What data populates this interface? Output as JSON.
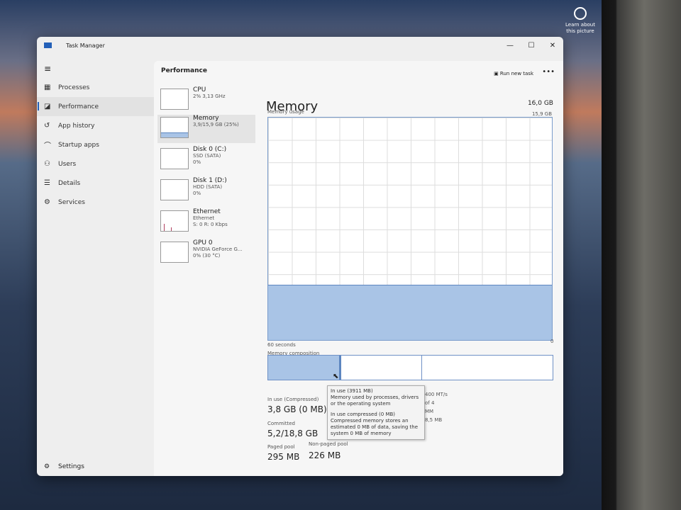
{
  "desktop": {
    "learn_label": "Learn about this picture"
  },
  "window": {
    "title": "Task Manager",
    "controls": [
      "—",
      "☐",
      "✕"
    ]
  },
  "sidebar": {
    "items": [
      {
        "label": "Processes",
        "icon": "▦"
      },
      {
        "label": "Performance",
        "icon": "◪"
      },
      {
        "label": "App history",
        "icon": "↺"
      },
      {
        "label": "Startup apps",
        "icon": "⌒"
      },
      {
        "label": "Users",
        "icon": "⚇"
      },
      {
        "label": "Details",
        "icon": "☰"
      },
      {
        "label": "Services",
        "icon": "⚙"
      }
    ],
    "active": "Performance",
    "settings": "Settings"
  },
  "header": {
    "title": "Performance",
    "run_new_task": "Run new task",
    "more": "•••"
  },
  "devices": [
    {
      "name": "CPU",
      "sub1": "2% 3,13 GHz",
      "sub2": ""
    },
    {
      "name": "Memory",
      "sub1": "3,9/15,9 GB (25%)",
      "sub2": ""
    },
    {
      "name": "Disk 0 (C:)",
      "sub1": "SSD (SATA)",
      "sub2": "0%"
    },
    {
      "name": "Disk 1 (D:)",
      "sub1": "HDD (SATA)",
      "sub2": "0%"
    },
    {
      "name": "Ethernet",
      "sub1": "Ethernet",
      "sub2": "S: 0 R: 0 Kbps"
    },
    {
      "name": "GPU 0",
      "sub1": "NVIDIA GeForce G...",
      "sub2": "0% (30 °C)"
    }
  ],
  "memory": {
    "title": "Memory",
    "total": "16,0 GB",
    "usage_label": "Memory usage",
    "usage_max": "15,9 GB",
    "usage_fraction": 0.25,
    "time_label": "60 seconds",
    "zero": "0",
    "composition_label": "Memory composition",
    "stats": {
      "in_use_label": "In use (Compressed)",
      "in_use": "3,8 GB (0 MB)",
      "committed_label": "Committed",
      "committed": "5,2/18,8 GB",
      "paged_label": "Paged pool",
      "paged": "295 MB",
      "nonpaged_label": "Non-paged pool",
      "nonpaged": "226 MB",
      "partial": [
        "400 MT/s",
        "of 4",
        "MM",
        "8,5 MB"
      ]
    }
  },
  "tooltip": {
    "l1": "In use (3911 MB)",
    "l2": "Memory used by processes, drivers or the operating system",
    "l3": "In use compressed (0 MB)",
    "l4": "Compressed memory stores an estimated 0 MB of data, saving the system 0 MB of memory"
  },
  "colors": {
    "accent": "#2460b8",
    "memory_fill": "#a9c4e6"
  }
}
